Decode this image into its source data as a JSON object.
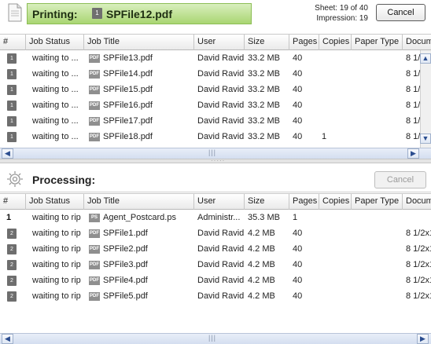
{
  "printing": {
    "label": "Printing:",
    "badge": "1",
    "file": "SPFile12.pdf",
    "sheet": "Sheet: 19 of 40",
    "impression": "Impression: 19",
    "cancel_label": "Cancel",
    "columns": [
      "#",
      "Job Status",
      "Job Title",
      "User",
      "Size",
      "Pages",
      "Copies",
      "Paper Type",
      "Docum"
    ],
    "rows": [
      {
        "num": "1",
        "status": "waiting to ...",
        "ftype": "PDF",
        "title": "SPFile13.pdf",
        "user": "David Ravid",
        "size": "33.2 MB",
        "pages": "40",
        "copies": "",
        "paper": "",
        "doc": "8 1/:"
      },
      {
        "num": "1",
        "status": "waiting to ...",
        "ftype": "PDF",
        "title": "SPFile14.pdf",
        "user": "David Ravid",
        "size": "33.2 MB",
        "pages": "40",
        "copies": "",
        "paper": "",
        "doc": "8 1/:"
      },
      {
        "num": "1",
        "status": "waiting to ...",
        "ftype": "PDF",
        "title": "SPFile15.pdf",
        "user": "David Ravid",
        "size": "33.2 MB",
        "pages": "40",
        "copies": "",
        "paper": "",
        "doc": "8 1/:"
      },
      {
        "num": "1",
        "status": "waiting to ...",
        "ftype": "PDF",
        "title": "SPFile16.pdf",
        "user": "David Ravid",
        "size": "33.2 MB",
        "pages": "40",
        "copies": "",
        "paper": "",
        "doc": "8 1/:"
      },
      {
        "num": "1",
        "status": "waiting to ...",
        "ftype": "PDF",
        "title": "SPFile17.pdf",
        "user": "David Ravid",
        "size": "33.2 MB",
        "pages": "40",
        "copies": "",
        "paper": "",
        "doc": "8 1/:"
      },
      {
        "num": "1",
        "status": "waiting to ...",
        "ftype": "PDF",
        "title": "SPFile18.pdf",
        "user": "David Ravid",
        "size": "33.2 MB",
        "pages": "40",
        "copies": "1",
        "paper": "",
        "doc": "8 1/:"
      }
    ]
  },
  "processing": {
    "label": "Processing:",
    "cancel_label": "Cancel",
    "columns": [
      "#",
      "Job Status",
      "Job Title",
      "User",
      "Size",
      "Pages",
      "Copies",
      "Paper Type",
      "Docum"
    ],
    "rows": [
      {
        "num": "1",
        "plain": true,
        "status": "waiting to rip",
        "ftype": "PS",
        "title": "Agent_Postcard.ps",
        "user": "Administr...",
        "size": "35.3 MB",
        "pages": "1",
        "copies": "",
        "paper": "",
        "doc": ""
      },
      {
        "num": "2",
        "status": "waiting to rip",
        "ftype": "PDF",
        "title": "SPFile1.pdf",
        "user": "David Ravid",
        "size": "4.2 MB",
        "pages": "40",
        "copies": "",
        "paper": "",
        "doc": "8 1/2x1"
      },
      {
        "num": "2",
        "status": "waiting to rip",
        "ftype": "PDF",
        "title": "SPFile2.pdf",
        "user": "David Ravid",
        "size": "4.2 MB",
        "pages": "40",
        "copies": "",
        "paper": "",
        "doc": "8 1/2x1"
      },
      {
        "num": "2",
        "status": "waiting to rip",
        "ftype": "PDF",
        "title": "SPFile3.pdf",
        "user": "David Ravid",
        "size": "4.2 MB",
        "pages": "40",
        "copies": "",
        "paper": "",
        "doc": "8 1/2x1"
      },
      {
        "num": "2",
        "status": "waiting to rip",
        "ftype": "PDF",
        "title": "SPFile4.pdf",
        "user": "David Ravid",
        "size": "4.2 MB",
        "pages": "40",
        "copies": "",
        "paper": "",
        "doc": "8 1/2x1"
      },
      {
        "num": "2",
        "status": "waiting to rip",
        "ftype": "PDF",
        "title": "SPFile5.pdf",
        "user": "David Ravid",
        "size": "4.2 MB",
        "pages": "40",
        "copies": "",
        "paper": "",
        "doc": "8 1/2x1"
      }
    ]
  },
  "icons": {
    "printing": "document-icon",
    "processing": "gear-icon",
    "scroll_up": "chevron-up-icon",
    "scroll_down": "chevron-down-icon",
    "scroll_left": "chevron-left-icon",
    "scroll_right": "chevron-right-icon"
  },
  "colors": {
    "printing_header": "#b6dc86",
    "scrollbar": "#d4def0",
    "badge": "#6e6e6e"
  }
}
